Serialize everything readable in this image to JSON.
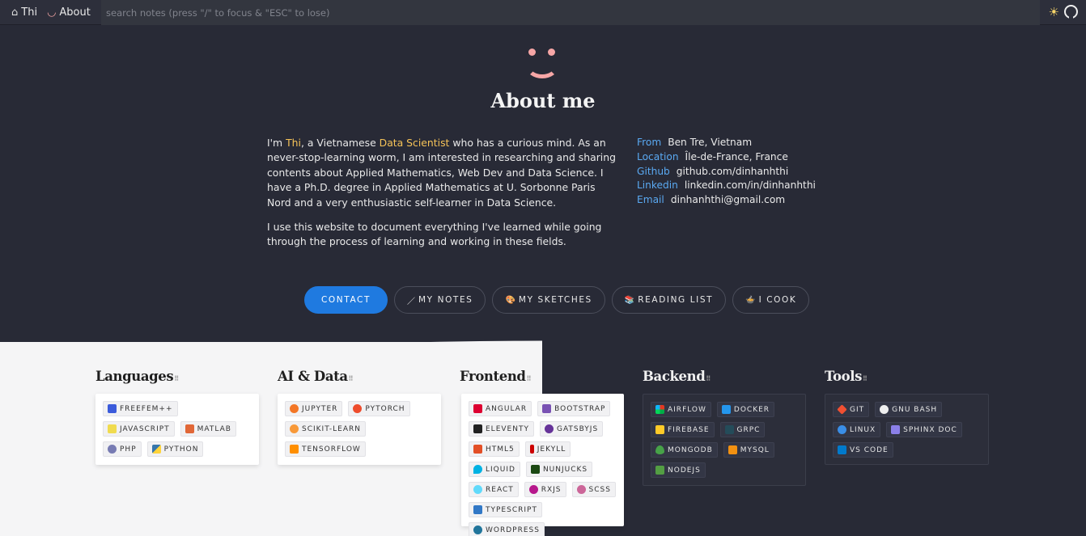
{
  "nav": {
    "home_label": "Thi",
    "about_label": "About",
    "search_placeholder": "search notes (press \"/\" to focus & \"ESC\" to lose)",
    "icons": [
      "home-icon",
      "smile-icon",
      "sun-icon",
      "github-icon"
    ]
  },
  "hero": {
    "title": "About me",
    "intro_p1_pre": "I'm ",
    "intro_p1_name": "Thi",
    "intro_p1_mid": ", a Vietnamese ",
    "intro_p1_role": "Data Scientist",
    "intro_p1_post": " who has a curious mind. As an never-stop-learning worm, I am interested in researching and sharing contents about Applied Mathematics, Web Dev and Data Science. I have a Ph.D. degree in Applied Mathematics at U. Sorbonne Paris Nord and a very enthusiastic self-learner in Data Science.",
    "intro_p2": "I use this website to document everything I've learned while going through the process of learning and working in these fields."
  },
  "info": [
    {
      "key": "From",
      "value": "Ben Tre, Vietnam"
    },
    {
      "key": "Location",
      "value": "Île-de-France, France"
    },
    {
      "key": "Github",
      "value": "github.com/dinhanhthi"
    },
    {
      "key": "Linkedin",
      "value": "linkedin.com/in/dinhanhthi"
    },
    {
      "key": "Email",
      "value": "dinhanhthi@gmail.com"
    }
  ],
  "buttons": {
    "contact": "CONTACT",
    "notes": "MY NOTES",
    "sketches": "MY SKETCHES",
    "reading": "READING LIST",
    "cook": "I COOK"
  },
  "categories": {
    "languages": "Languages",
    "ai_data": "AI & Data",
    "frontend": "Frontend",
    "backend": "Backend",
    "tools": "Tools"
  },
  "tags": {
    "languages": [
      "FREEFEM++",
      "JAVASCRIPT",
      "MATLAB",
      "PHP",
      "PYTHON"
    ],
    "ai_data": [
      "JUPYTER",
      "PYTORCH",
      "SCIKIT-LEARN",
      "TENSORFLOW"
    ],
    "frontend": [
      "ANGULAR",
      "BOOTSTRAP",
      "ELEVENTY",
      "GATSBYJS",
      "HTML5",
      "JEKYLL",
      "LIQUID",
      "NUNJUCKS",
      "REACT",
      "RXJS",
      "SCSS",
      "TYPESCRIPT",
      "WORDPRESS"
    ],
    "backend": [
      "AIRFLOW",
      "DOCKER",
      "FIREBASE",
      "GRPC",
      "MONGODB",
      "MYSQL",
      "NODEJS"
    ],
    "tools": [
      "GIT",
      "GNU BASH",
      "LINUX",
      "SPHINX DOC",
      "VS CODE"
    ]
  },
  "colors": {
    "accent": "#1f7ae0",
    "highlight": "#f6c358",
    "info_key": "#5aa9f2",
    "smiley": "#f6a6a6",
    "dark_bg": "#282a36",
    "light_bg": "#f5f5f6"
  }
}
